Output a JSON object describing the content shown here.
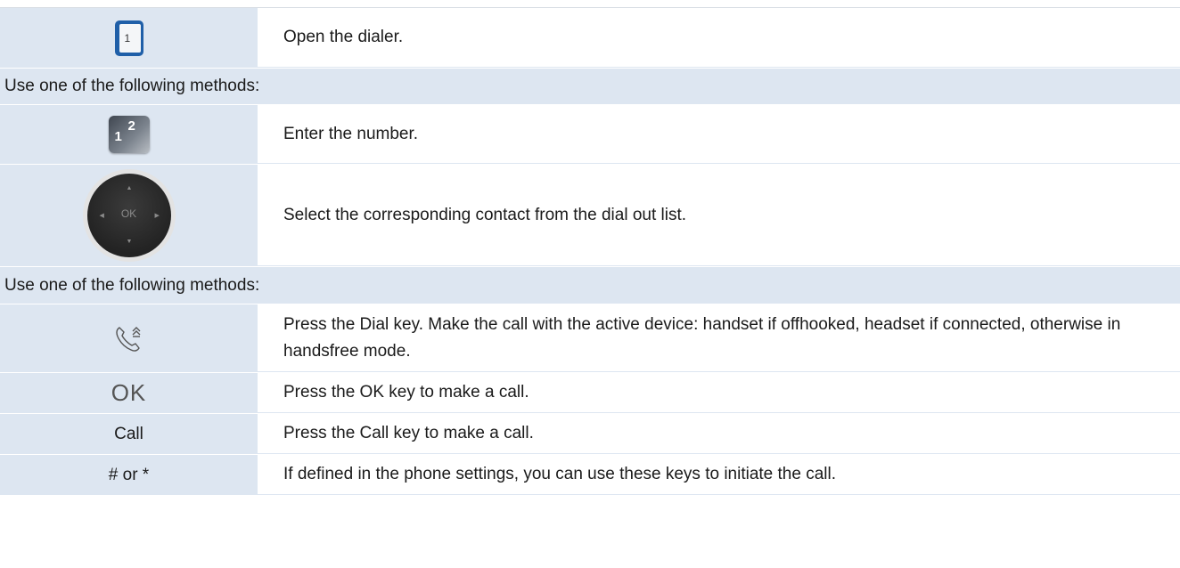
{
  "rows": [
    {
      "kind": "step",
      "icon": "dialer-icon",
      "dialer_digit": "1",
      "text": "Open the dialer."
    },
    {
      "kind": "header",
      "text": "Use one of the following methods:"
    },
    {
      "kind": "step",
      "icon": "keypad-icon",
      "keypad_digits": [
        "1",
        "2"
      ],
      "text": "Enter the number."
    },
    {
      "kind": "step",
      "icon": "navigator-icon",
      "nav_label": "OK",
      "text": "Select the corresponding contact from the dial out list."
    },
    {
      "kind": "header",
      "text": "Use one of the following methods:"
    },
    {
      "kind": "step",
      "icon": "dial-key-icon",
      "text": "Press the Dial key. Make the call with the active device: handset if offhooked, headset if connected, otherwise in handsfree mode."
    },
    {
      "kind": "step",
      "key_label": "OK",
      "text": "Press the OK key to make a call."
    },
    {
      "kind": "step",
      "key_label": "Call",
      "text": "Press the Call key to make a call."
    },
    {
      "kind": "step",
      "key_label": "# or *",
      "text": "If defined in the phone settings, you can use these keys to initiate the call."
    }
  ],
  "colors": {
    "header_bg": "#dde6f1",
    "left_cell_bg": "#dde6f1",
    "dialer_blue": "#1f5fa8"
  }
}
